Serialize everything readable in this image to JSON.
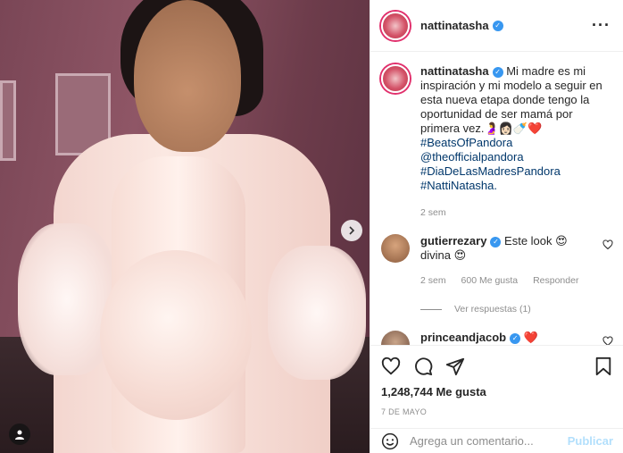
{
  "post": {
    "username": "nattinatasha",
    "caption_text": "Mi madre es mi inspiración y mi modelo a seguir en esta nueva etapa donde tengo la oportunidad de ser mamá por primera vez.",
    "caption_emoji": "🤰👩🏻🍼❤️",
    "hashtags": [
      "#BeatsOfPandora",
      "@theofficialpandora",
      "#DiaDeLasMadresPandora",
      "#NattiNatasha."
    ],
    "caption_age": "2 sem",
    "likes": "1,248,744 Me gusta",
    "date": "7 DE MAYO"
  },
  "comments": [
    {
      "username": "gutierrezary",
      "text": "Este look 😍 divina 😍",
      "age": "2 sem",
      "likes": "600 Me gusta",
      "reply_label": "Responder",
      "view_replies": "Ver respuestas (1)"
    },
    {
      "username": "princeandjacob",
      "text": "❤️"
    }
  ],
  "add_comment": {
    "placeholder": "Agrega un comentario...",
    "publish_label": "Publicar"
  },
  "icons": {
    "more": "more-options-icon",
    "like": "heart-icon",
    "comment": "comment-icon",
    "share": "share-icon",
    "save": "bookmark-icon",
    "emoji": "emoji-icon",
    "next": "chevron-right-icon",
    "user_tag": "user-tag-icon"
  },
  "colors": {
    "verified": "#3897f0",
    "link": "#00376b",
    "muted": "#8e8e8e",
    "publish_disabled": "#b2dffc"
  }
}
